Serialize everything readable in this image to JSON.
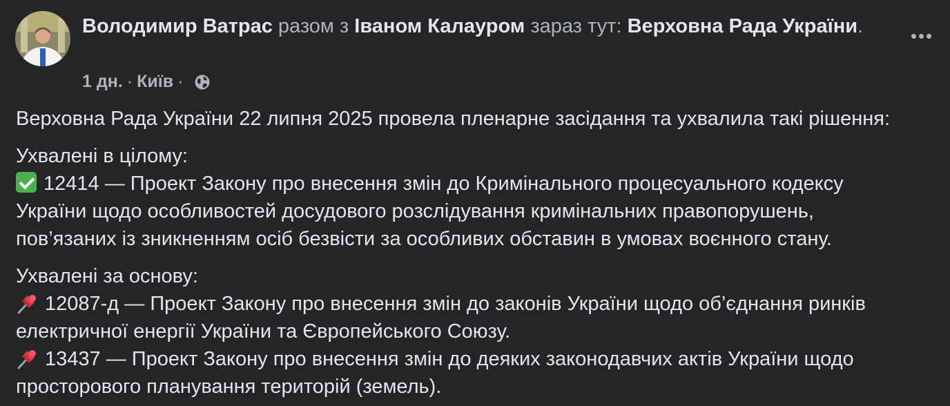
{
  "post": {
    "author": "Володимир Ватрас",
    "with_text": "разом з",
    "tagged": "Іваном Калауром",
    "location_prefix": "зараз тут:",
    "place": "Верховна Рада України",
    "period": ".",
    "time": "1 дн.",
    "separator": "·",
    "city": "Київ",
    "audience_icon": "globe-icon",
    "more_icon": "more-options-icon"
  },
  "content": {
    "intro": "Верховна Рада України 22 липня 2025 провела пленарне засідання та ухвалила такі рішення:",
    "section1_title": "Ухвалені в цілому:",
    "section1_items": [
      {
        "emoji": "check-mark-emoji",
        "line1": "12414 — Проект Закону про внесення змін до Кримінального процесуального кодексу",
        "line2": "України щодо особливостей досудового розслідування кримінальних правопорушень,",
        "line3": "пов’язаних із зникненням осіб безвісти за особливих обставин в умовах воєнного стану."
      }
    ],
    "section2_title": "Ухвалені за основу:",
    "section2_items": [
      {
        "emoji": "pushpin-emoji",
        "line1": "12087-д — Проект Закону про внесення змін до законів України щодо об’єднання ринків",
        "line2": "електричної енергії України та Європейського Союзу."
      },
      {
        "emoji": "pushpin-emoji",
        "line1": "13437 — Проект Закону про внесення змін до деяких законодавчих актів України щодо",
        "line2": "просторового планування територій (земель)."
      }
    ]
  },
  "colors": {
    "background": "#242526",
    "primary_text": "#e4e6eb",
    "secondary_text": "#b0b3b8"
  }
}
